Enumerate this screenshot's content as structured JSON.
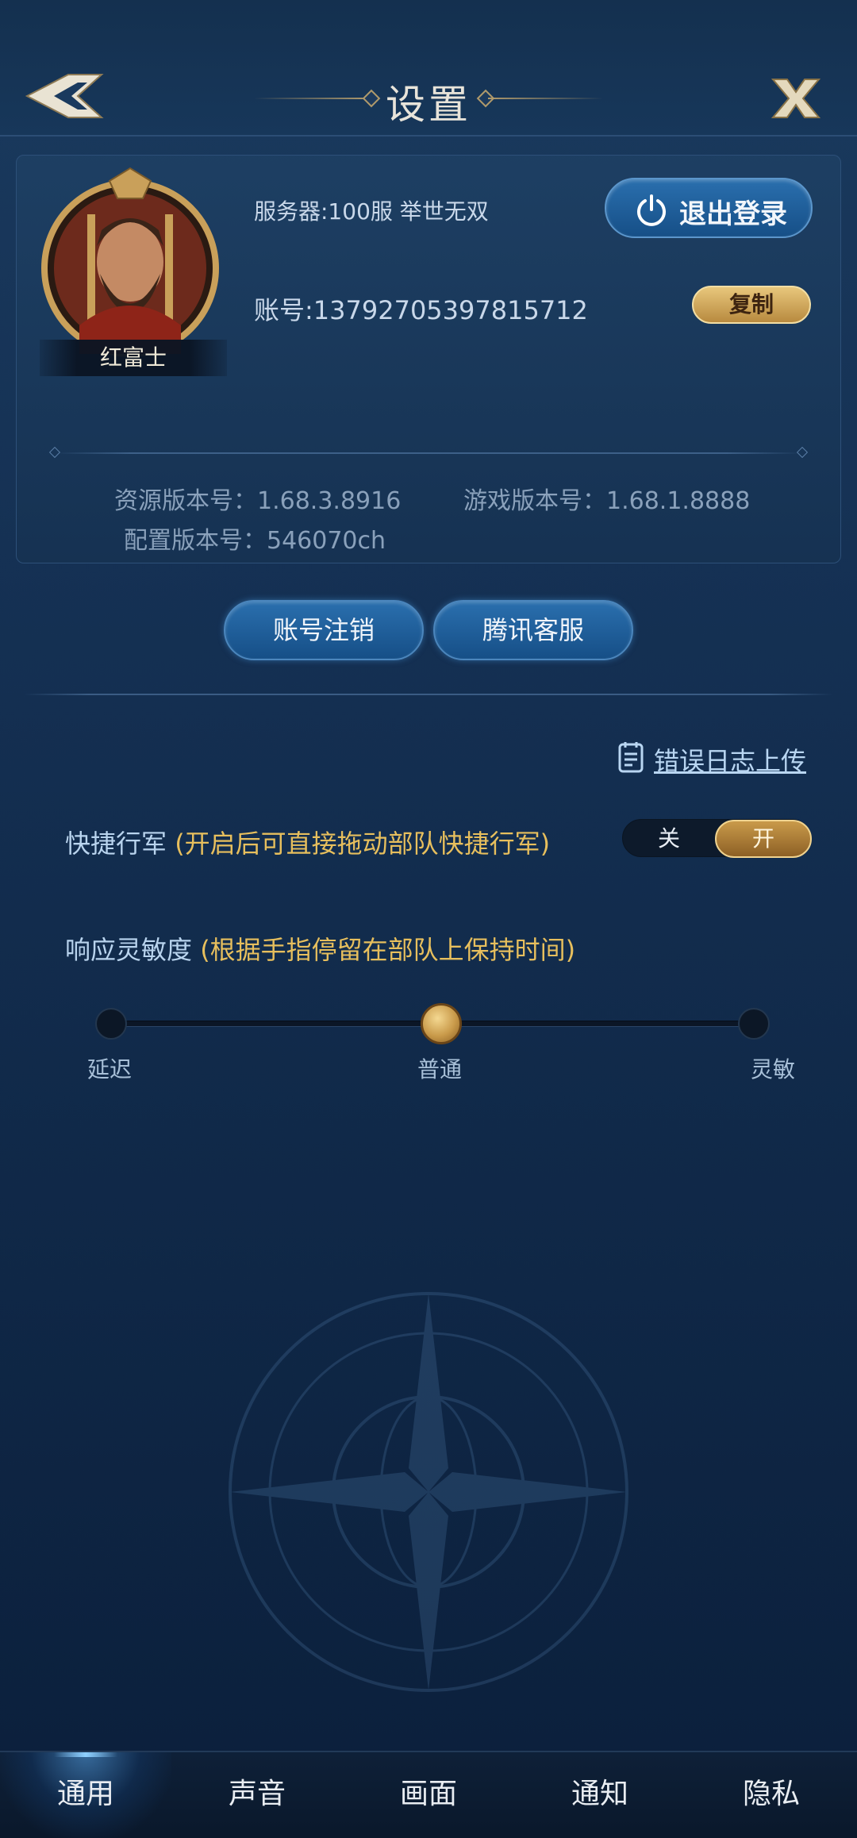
{
  "header": {
    "title": "设置"
  },
  "profile": {
    "name": "红富士",
    "server": "服务器:100服 举世无双",
    "logout_label": "退出登录",
    "account": "账号:13792705397815712",
    "copy_label": "复制"
  },
  "versions": {
    "resource": "资源版本号：1.68.3.8916",
    "game": "游戏版本号：1.68.1.8888",
    "config": "配置版本号：546070ch"
  },
  "actions": {
    "deactivate_label": "账号注销",
    "support_label": "腾讯客服"
  },
  "error_log": {
    "label": "错误日志上传"
  },
  "quick_march": {
    "label": "快捷行军",
    "hint": "(开启后可直接拖动部队快捷行军)",
    "off_label": "关",
    "on_label": "开",
    "value": "开"
  },
  "sensitivity": {
    "label": "响应灵敏度",
    "hint": "(根据手指停留在部队上保持时间)",
    "options": [
      "延迟",
      "普通",
      "灵敏"
    ],
    "selected": "普通"
  },
  "tabs": [
    {
      "label": "通用",
      "active": true
    },
    {
      "label": "声音",
      "active": false
    },
    {
      "label": "画面",
      "active": false
    },
    {
      "label": "通知",
      "active": false
    },
    {
      "label": "隐私",
      "active": false
    }
  ],
  "colors": {
    "accent_gold": "#e7bf5d",
    "button_blue": "#1f5f9c",
    "background": "#153154"
  }
}
